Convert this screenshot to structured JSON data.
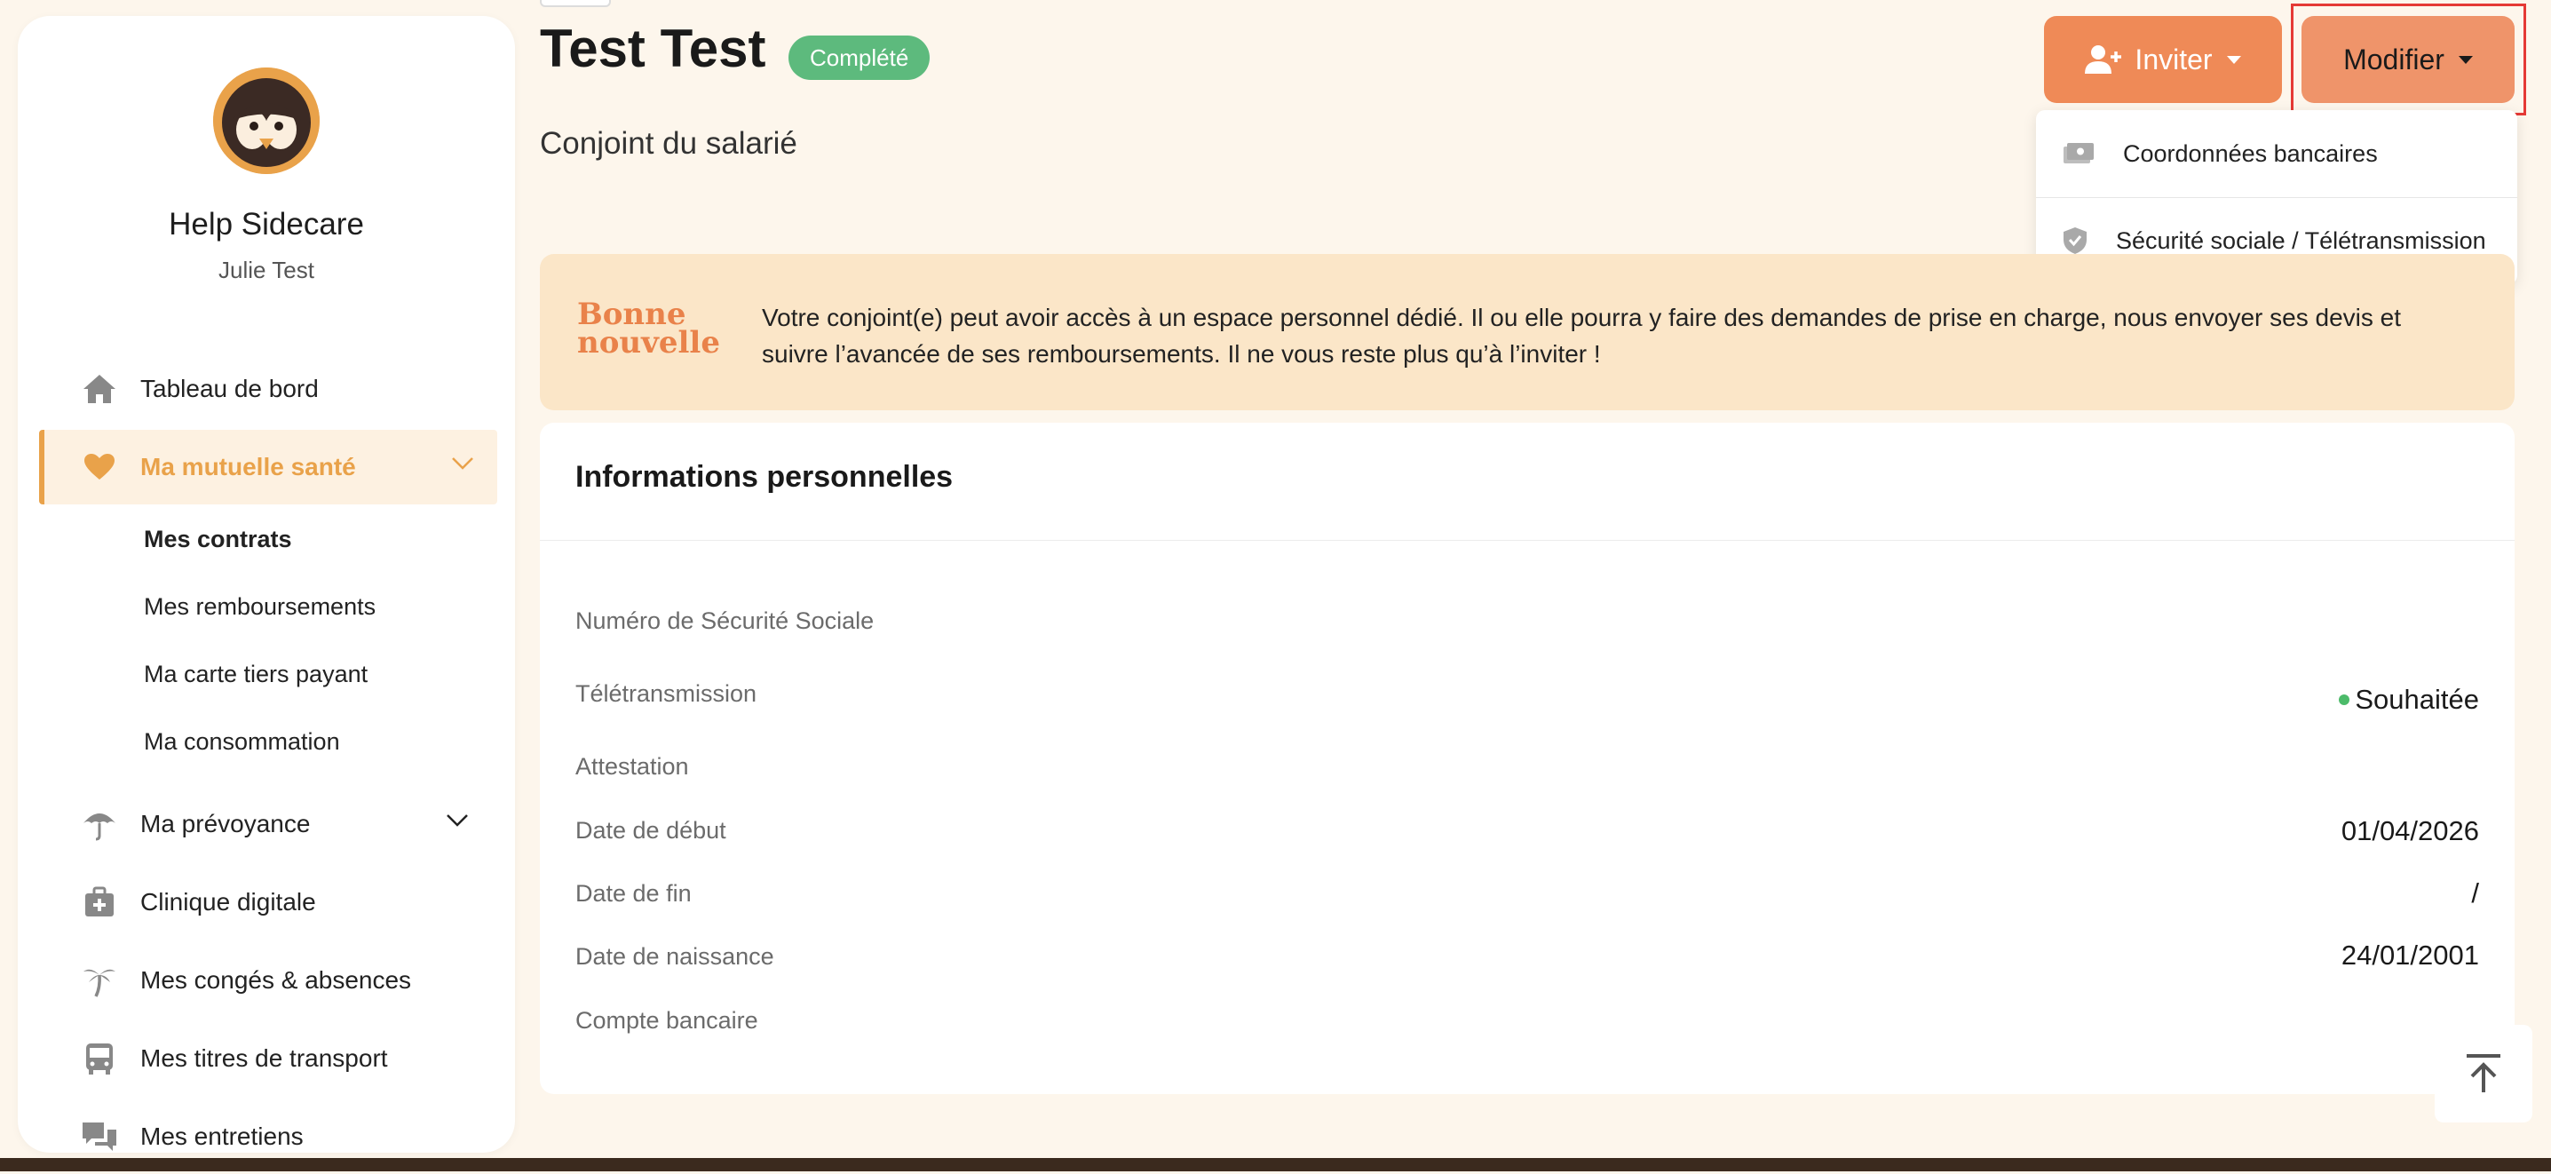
{
  "sidebar": {
    "org_name": "Help Sidecare",
    "user_name": "Julie Test",
    "nav": {
      "dashboard": "Tableau de bord",
      "health": "Ma mutuelle santé",
      "contracts": "Mes contrats",
      "reimbursements": "Mes remboursements",
      "card": "Ma carte tiers payant",
      "consumption": "Ma consommation",
      "provident": "Ma prévoyance",
      "clinic": "Clinique digitale",
      "leave": "Mes congés & absences",
      "transport": "Mes titres de transport",
      "interviews": "Mes entretiens"
    }
  },
  "header": {
    "title": "Test Test",
    "status": "Complété",
    "subtitle": "Conjoint du salarié",
    "invite_label": "Inviter",
    "modify_label": "Modifier"
  },
  "dropdown": {
    "items": [
      "Coordonnées bancaires",
      "Sécurité sociale / Télétransmission"
    ]
  },
  "banner": {
    "title_line1": "Bonne",
    "title_line2": "nouvelle",
    "text": "Votre conjoint(e) peut avoir accès à un espace personnel dédié. Il ou elle pourra y faire des demandes de prise en charge, nous envoyer ses devis et suivre l’avancée de ses remboursements. Il ne vous reste plus qu’à l’inviter !"
  },
  "card": {
    "title": "Informations personnelles",
    "fields": {
      "ssn_label": "Numéro de Sécurité Sociale",
      "tele_label": "Télétransmission",
      "tele_value": "Souhaitée",
      "attestation_label": "Attestation",
      "start_label": "Date de début",
      "start_value": "01/04/2026",
      "end_label": "Date de fin",
      "end_value": "/",
      "birth_label": "Date de naissance",
      "birth_value": "24/01/2001",
      "bank_label": "Compte bancaire"
    }
  },
  "colors": {
    "accent": "#e9a24a",
    "invite": "#ef8a57",
    "modify": "#ef946a",
    "status": "#5dba7d",
    "banner_bg": "#fbe6c8",
    "highlight": "#e53935"
  }
}
